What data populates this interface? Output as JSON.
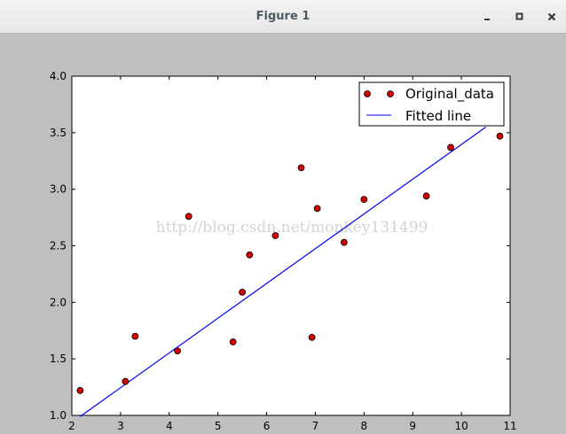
{
  "window": {
    "title": "Figure 1",
    "buttons": {
      "minimize_icon": "minimize-icon",
      "maximize_icon": "maximize-icon",
      "close_icon": "close-icon"
    }
  },
  "watermark": "http://blog.csdn.net/monkey131499",
  "chart_data": {
    "type": "scatter",
    "title": "",
    "xlabel": "",
    "ylabel": "",
    "xlim": [
      2,
      11
    ],
    "ylim": [
      1.0,
      4.0
    ],
    "xticks": [
      "2",
      "3",
      "4",
      "5",
      "6",
      "7",
      "8",
      "9",
      "10",
      "11"
    ],
    "yticks": [
      "1.0",
      "1.5",
      "2.0",
      "2.5",
      "3.0",
      "3.5",
      "4.0"
    ],
    "grid": false,
    "legend_position": "top-right",
    "series": [
      {
        "name": "Original_data",
        "kind": "scatter",
        "color": "#d40000",
        "x": [
          2.17,
          3.1,
          3.3,
          4.17,
          4.4,
          5.31,
          5.5,
          5.65,
          6.18,
          6.71,
          6.93,
          7.04,
          7.59,
          8.0,
          9.28,
          9.78,
          10.79
        ],
        "y": [
          1.22,
          1.3,
          1.7,
          1.57,
          2.76,
          1.65,
          2.09,
          2.42,
          2.59,
          3.19,
          1.69,
          2.83,
          2.53,
          2.91,
          2.94,
          3.37,
          3.47
        ]
      },
      {
        "name": "Fitted line",
        "kind": "line",
        "color": "#0000ff",
        "x": [
          2.17,
          10.5
        ],
        "y": [
          0.99,
          3.55
        ]
      }
    ]
  }
}
